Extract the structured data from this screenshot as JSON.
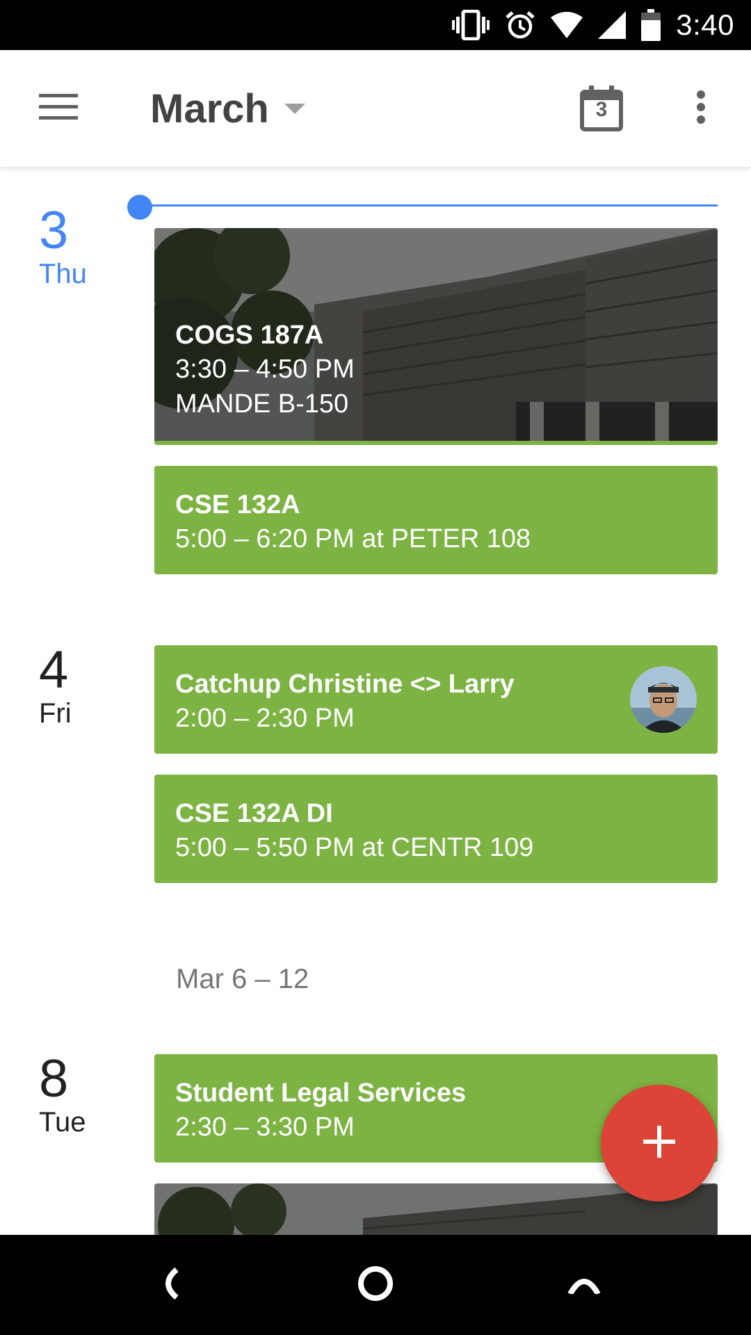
{
  "status_bar": {
    "time": "3:40",
    "icons": [
      "vibrate-icon",
      "alarm-icon",
      "wifi-icon",
      "signal-icon",
      "battery-icon"
    ]
  },
  "app_bar": {
    "title": "March",
    "today_date": "3",
    "icons": [
      "menu-icon",
      "dropdown-caret-icon",
      "calendar-today-icon",
      "more-vert-icon"
    ]
  },
  "days": [
    {
      "num": "3",
      "dow": "Thu",
      "is_today": true,
      "events": [
        {
          "title": "COGS 187A",
          "time": "3:30 – 4:50 PM",
          "location": "MANDE B-150",
          "has_photo": true
        },
        {
          "title": "CSE 132A",
          "detail": "5:00 – 6:20 PM at PETER 108"
        }
      ]
    },
    {
      "num": "4",
      "dow": "Fri",
      "events": [
        {
          "title": "Catchup Christine <> Larry",
          "detail": "2:00 – 2:30 PM",
          "has_avatar": true
        },
        {
          "title": "CSE 132A DI",
          "detail": "5:00 – 5:50 PM at CENTR 109"
        }
      ]
    },
    {
      "num": "8",
      "dow": "Tue",
      "events": [
        {
          "title": "Student Legal Services",
          "detail": "2:30 – 3:30 PM"
        }
      ]
    }
  ],
  "week_header": "Mar 6 – 12",
  "colors": {
    "event_green": "#7cb342",
    "today_blue": "#4285f4",
    "fab_red": "#db4437"
  },
  "fab_icon": "add-icon",
  "nav_bar": {
    "icons": [
      "back-icon",
      "home-icon",
      "recents-icon"
    ]
  }
}
